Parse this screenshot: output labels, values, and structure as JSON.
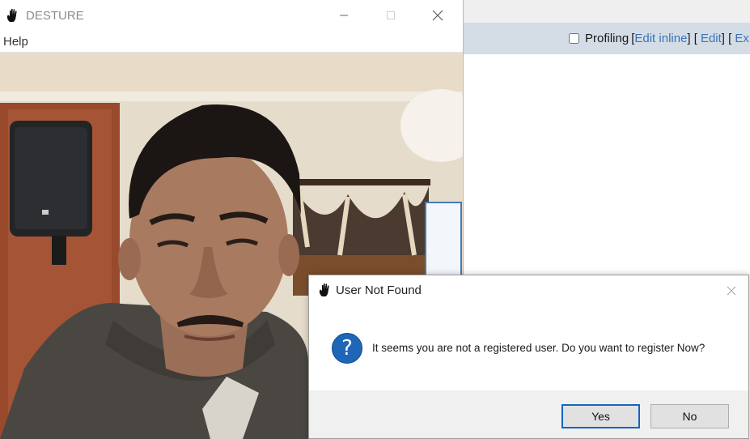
{
  "background_page": {
    "toolbar": {
      "profiling_label": "Profiling",
      "bracket_open": "[",
      "edit_inline": "Edit inline",
      "bracket_mid": "] [",
      "edit": "Edit",
      "bracket_mid2": "] [",
      "ex": "Ex"
    }
  },
  "main_window": {
    "title": "DESTURE",
    "menu": {
      "help": "Help"
    }
  },
  "dialog": {
    "title": "User Not Found",
    "message": "It seems you are not a registered user. Do you want to register Now?",
    "icon": "question-icon",
    "question_glyph": "?",
    "buttons": {
      "yes": "Yes",
      "no": "No"
    }
  },
  "colors": {
    "toolbar_bg": "#d4dde6",
    "link": "#3b73b9",
    "question_icon": "#1f66b8",
    "default_button_border": "#1665c0"
  }
}
